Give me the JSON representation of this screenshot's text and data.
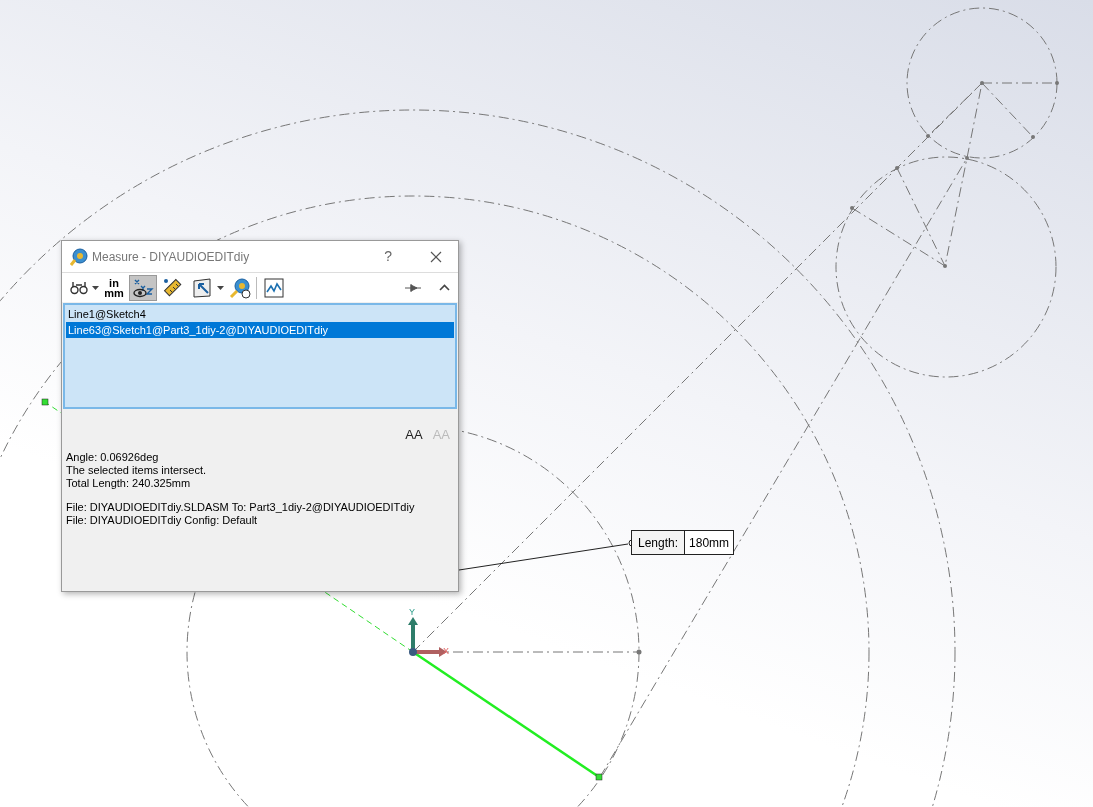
{
  "dialog": {
    "title": "Measure - DIYAUDIOEDITdiy",
    "help": "?",
    "toolbar": [
      {
        "kind": "binoculars",
        "dropdown": true,
        "pressed": false
      },
      {
        "kind": "units",
        "label_top": "in",
        "label_bottom": "mm",
        "dropdown": false,
        "pressed": false
      },
      {
        "kind": "xyz",
        "dropdown": false,
        "pressed": true
      },
      {
        "kind": "ruler",
        "dropdown": false,
        "pressed": false
      },
      {
        "kind": "arrow",
        "dropdown": true,
        "pressed": false
      },
      {
        "kind": "point",
        "dropdown": false,
        "pressed": false
      },
      {
        "kind": "graph",
        "dropdown": false,
        "pressed": false
      }
    ],
    "selections": [
      {
        "label": "Line1@Sketch4",
        "selected": false
      },
      {
        "label": "Line63@Sketch1@Part3_1diy-2@DIYAUDIOEDITdiy",
        "selected": true
      }
    ],
    "font_buttons": [
      {
        "label": "AA",
        "disabled": false
      },
      {
        "label": "AA",
        "disabled": true
      }
    ],
    "results": [
      [
        "Angle: 0.06926deg",
        "The selected items intersect.",
        "Total Length: 240.325mm"
      ],
      [
        "File: DIYAUDIOEDITdiy.SLDASM To: Part3_1diy-2@DIYAUDIOEDITdiy",
        "File: DIYAUDIOEDITdiy Config: Default"
      ]
    ]
  },
  "callout": {
    "label": "Length:",
    "value": "180mm"
  },
  "axes": {
    "x": "X",
    "y": "Y"
  }
}
